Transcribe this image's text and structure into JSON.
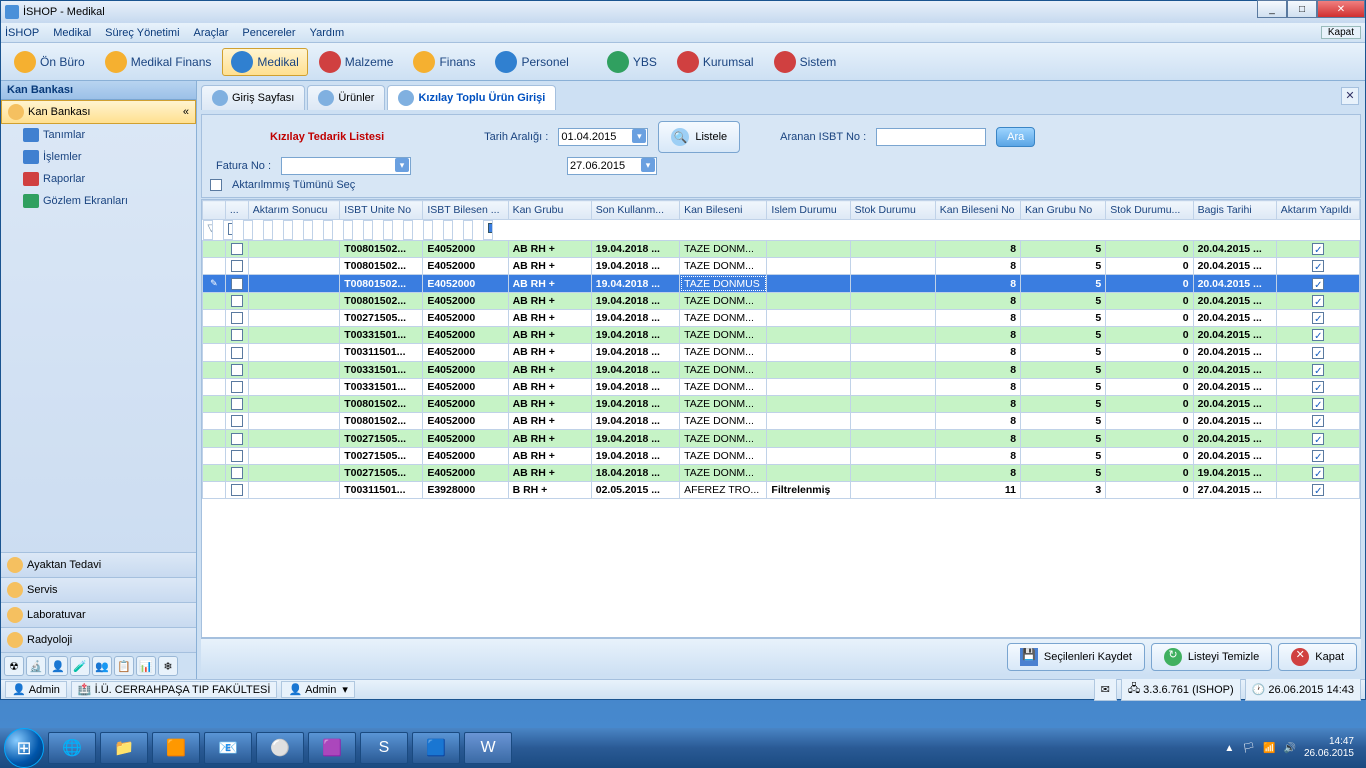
{
  "window": {
    "title": "İSHOP - Medikal",
    "right_button": "Kapat"
  },
  "menubar": [
    "İSHOP",
    "Medikal",
    "Süreç Yönetimi",
    "Araçlar",
    "Pencereler",
    "Yardım"
  ],
  "toolbar": [
    {
      "label": "Ön Büro",
      "color": "#f5b030"
    },
    {
      "label": "Medikal Finans",
      "color": "#f5b030"
    },
    {
      "label": "Medikal",
      "color": "#3080d0",
      "active": true
    },
    {
      "label": "Malzeme",
      "color": "#d04040"
    },
    {
      "label": "Finans",
      "color": "#f5b030"
    },
    {
      "label": "Personel",
      "color": "#3080d0"
    },
    {
      "label": "YBS",
      "color": "#30a060"
    },
    {
      "label": "Kurumsal",
      "color": "#d04040"
    },
    {
      "label": "Sistem",
      "color": "#d04040"
    }
  ],
  "sidebar": {
    "header": "Kan Bankası",
    "active": "Kan Bankası",
    "collapse": "«",
    "items": [
      {
        "label": "Tanımlar",
        "icon": "#4080d0"
      },
      {
        "label": "İşlemler",
        "icon": "#4080d0"
      },
      {
        "label": "Raporlar",
        "icon": "#d04040"
      },
      {
        "label": "Gözlem Ekranları",
        "icon": "#30a060"
      }
    ],
    "panels": [
      "Ayaktan Tedavi",
      "Servis",
      "Laboratuvar",
      "Radyoloji"
    ],
    "bottom_icons": [
      "☢",
      "🔬",
      "👤",
      "🧪",
      "👥",
      "📋",
      "📊",
      "❄"
    ]
  },
  "tabs": [
    {
      "label": "Giriş Sayfası"
    },
    {
      "label": "Ürünler"
    },
    {
      "label": "Kızılay Toplu Ürün Girişi",
      "active": true
    }
  ],
  "filter": {
    "title": "Kızılay Tedarik Listesi",
    "fatura_label": "Fatura No :",
    "tarih_label": "Tarih Aralığı :",
    "tarih1": "01.04.2015",
    "tarih2": "27.06.2015",
    "listele": "Listele",
    "isbt_label": "Aranan ISBT No :",
    "ara": "Ara",
    "aktarilmamis": "Aktarılmmış Tümünü Seç"
  },
  "grid": {
    "headers": [
      "...",
      "Aktarım Sonucu",
      "ISBT Unite No",
      "ISBT Bilesen ...",
      "Kan Grubu",
      "Son Kullanm...",
      "Kan Bileseni",
      "Islem Durumu",
      "Stok Durumu",
      "Kan Bileseni No",
      "Kan Grubu No",
      "Stok Durumu...",
      "Bagis Tarihi",
      "Aktarım Yapıldı"
    ],
    "rows": [
      {
        "isbt": "T00801502...",
        "bilesen": "E4052000",
        "kan": "AB RH +",
        "sk": "19.04.2018 ...",
        "kb": "TAZE DONM...",
        "id": "",
        "sd": "",
        "kbn": "8",
        "kgn": "5",
        "sdn": "0",
        "bg": "20.04.2015 ...",
        "ay": true,
        "sel": false,
        "even": true
      },
      {
        "isbt": "T00801502...",
        "bilesen": "E4052000",
        "kan": "AB RH +",
        "sk": "19.04.2018 ...",
        "kb": "TAZE DONM...",
        "id": "",
        "sd": "",
        "kbn": "8",
        "kgn": "5",
        "sdn": "0",
        "bg": "20.04.2015 ...",
        "ay": true,
        "sel": false,
        "even": false
      },
      {
        "isbt": "T00801502...",
        "bilesen": "E4052000",
        "kan": "AB RH +",
        "sk": "19.04.2018 ...",
        "kb": "TAZE DONMUS",
        "id": "",
        "sd": "",
        "kbn": "8",
        "kgn": "5",
        "sdn": "0",
        "bg": "20.04.2015 ...",
        "ay": true,
        "sel": true,
        "even": true
      },
      {
        "isbt": "T00801502...",
        "bilesen": "E4052000",
        "kan": "AB RH +",
        "sk": "19.04.2018 ...",
        "kb": "TAZE DONM...",
        "id": "",
        "sd": "",
        "kbn": "8",
        "kgn": "5",
        "sdn": "0",
        "bg": "20.04.2015 ...",
        "ay": true,
        "sel": false,
        "even": true
      },
      {
        "isbt": "T00271505...",
        "bilesen": "E4052000",
        "kan": "AB RH +",
        "sk": "19.04.2018 ...",
        "kb": "TAZE DONM...",
        "id": "",
        "sd": "",
        "kbn": "8",
        "kgn": "5",
        "sdn": "0",
        "bg": "20.04.2015 ...",
        "ay": true,
        "sel": false,
        "even": false
      },
      {
        "isbt": "T00331501...",
        "bilesen": "E4052000",
        "kan": "AB RH +",
        "sk": "19.04.2018 ...",
        "kb": "TAZE DONM...",
        "id": "",
        "sd": "",
        "kbn": "8",
        "kgn": "5",
        "sdn": "0",
        "bg": "20.04.2015 ...",
        "ay": true,
        "sel": false,
        "even": true
      },
      {
        "isbt": "T00311501...",
        "bilesen": "E4052000",
        "kan": "AB RH +",
        "sk": "19.04.2018 ...",
        "kb": "TAZE DONM...",
        "id": "",
        "sd": "",
        "kbn": "8",
        "kgn": "5",
        "sdn": "0",
        "bg": "20.04.2015 ...",
        "ay": true,
        "sel": false,
        "even": false
      },
      {
        "isbt": "T00331501...",
        "bilesen": "E4052000",
        "kan": "AB RH +",
        "sk": "19.04.2018 ...",
        "kb": "TAZE DONM...",
        "id": "",
        "sd": "",
        "kbn": "8",
        "kgn": "5",
        "sdn": "0",
        "bg": "20.04.2015 ...",
        "ay": true,
        "sel": false,
        "even": true
      },
      {
        "isbt": "T00331501...",
        "bilesen": "E4052000",
        "kan": "AB RH +",
        "sk": "19.04.2018 ...",
        "kb": "TAZE DONM...",
        "id": "",
        "sd": "",
        "kbn": "8",
        "kgn": "5",
        "sdn": "0",
        "bg": "20.04.2015 ...",
        "ay": true,
        "sel": false,
        "even": false
      },
      {
        "isbt": "T00801502...",
        "bilesen": "E4052000",
        "kan": "AB RH +",
        "sk": "19.04.2018 ...",
        "kb": "TAZE DONM...",
        "id": "",
        "sd": "",
        "kbn": "8",
        "kgn": "5",
        "sdn": "0",
        "bg": "20.04.2015 ...",
        "ay": true,
        "sel": false,
        "even": true
      },
      {
        "isbt": "T00801502...",
        "bilesen": "E4052000",
        "kan": "AB RH +",
        "sk": "19.04.2018 ...",
        "kb": "TAZE DONM...",
        "id": "",
        "sd": "",
        "kbn": "8",
        "kgn": "5",
        "sdn": "0",
        "bg": "20.04.2015 ...",
        "ay": true,
        "sel": false,
        "even": false
      },
      {
        "isbt": "T00271505...",
        "bilesen": "E4052000",
        "kan": "AB RH +",
        "sk": "19.04.2018 ...",
        "kb": "TAZE DONM...",
        "id": "",
        "sd": "",
        "kbn": "8",
        "kgn": "5",
        "sdn": "0",
        "bg": "20.04.2015 ...",
        "ay": true,
        "sel": false,
        "even": true
      },
      {
        "isbt": "T00271505...",
        "bilesen": "E4052000",
        "kan": "AB RH +",
        "sk": "19.04.2018 ...",
        "kb": "TAZE DONM...",
        "id": "",
        "sd": "",
        "kbn": "8",
        "kgn": "5",
        "sdn": "0",
        "bg": "20.04.2015 ...",
        "ay": true,
        "sel": false,
        "even": false
      },
      {
        "isbt": "T00271505...",
        "bilesen": "E4052000",
        "kan": "AB RH +",
        "sk": "18.04.2018 ...",
        "kb": "TAZE DONM...",
        "id": "",
        "sd": "",
        "kbn": "8",
        "kgn": "5",
        "sdn": "0",
        "bg": "19.04.2015 ...",
        "ay": true,
        "sel": false,
        "even": true
      },
      {
        "isbt": "T00311501...",
        "bilesen": "E3928000",
        "kan": "B RH +",
        "sk": "02.05.2015 ...",
        "kb": "AFEREZ TRO...",
        "id": "Filtrelenmiş",
        "sd": "",
        "kbn": "11",
        "kgn": "3",
        "sdn": "0",
        "bg": "27.04.2015 ...",
        "ay": true,
        "sel": false,
        "even": false
      }
    ]
  },
  "bottom": {
    "save": "Seçilenleri Kaydet",
    "clear": "Listeyi Temizle",
    "close": "Kapat"
  },
  "status": {
    "user": "Admin",
    "location": "İ.Ü. CERRAHPAŞA TIP FAKÜLTESİ",
    "admin_drop": "Admin",
    "version": "3.3.6.761 (ISHOP)",
    "datetime": "26.06.2015 14:43"
  },
  "taskbar": {
    "time": "14:47",
    "date": "26.06.2015",
    "icons": [
      "▲",
      "🏳",
      "📶",
      "🔊"
    ]
  }
}
